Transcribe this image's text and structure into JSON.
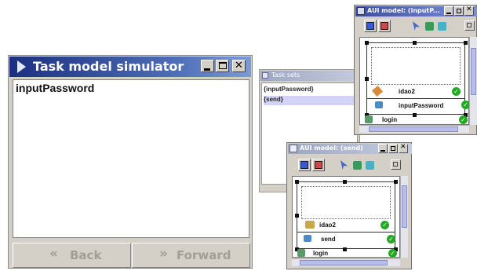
{
  "simulator": {
    "title": "Task model simulator",
    "content": "inputPassword",
    "back_label": "Back",
    "forward_label": "Forward",
    "back_glyph": "«",
    "forward_glyph": "»"
  },
  "task_sets": {
    "title": "Task sets",
    "items": [
      "{inputPassword}",
      "{send}"
    ],
    "selected_index": 1
  },
  "aui_top": {
    "title": "AUI model: (inputP...",
    "rows": [
      "idao2",
      "inputPassword",
      "login"
    ]
  },
  "aui_bottom": {
    "title": "AUI model: (send)",
    "rows": [
      "idao2",
      "send",
      "login"
    ]
  },
  "window_buttons": {
    "minimize": "_",
    "maximize": "□",
    "close": "✕"
  },
  "check_glyph": "✓",
  "colors": {
    "title_dark": "#1b2f80",
    "title_light": "#7e9ad6",
    "selection": "#d3d3f8",
    "check_green": "#22aa22"
  }
}
